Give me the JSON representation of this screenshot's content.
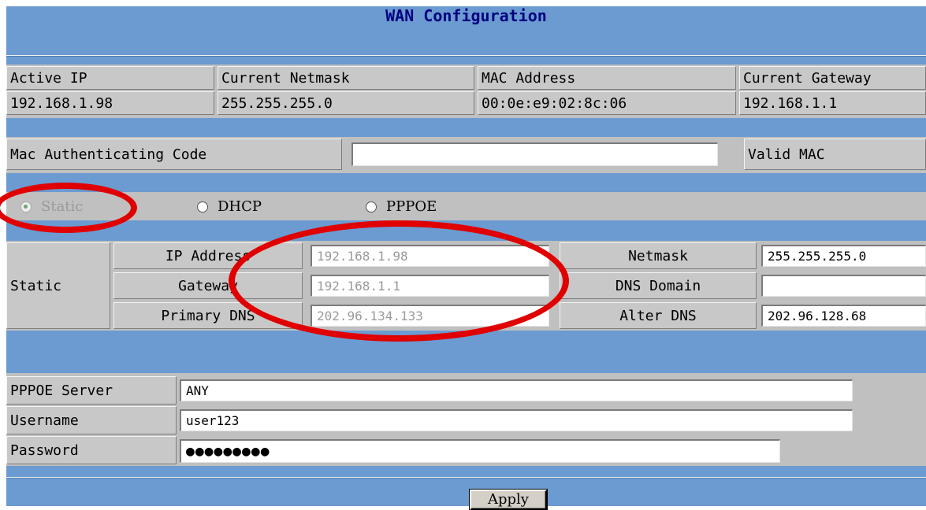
{
  "page_title": "WAN Configuration",
  "status": {
    "headers": [
      "Active IP",
      "Current Netmask",
      "MAC Address",
      "Current Gateway"
    ],
    "values": [
      "192.168.1.98",
      "255.255.255.0",
      "00:0e:e9:02:8c:06",
      "192.168.1.1"
    ]
  },
  "mac_auth": {
    "label": "Mac Authenticating Code",
    "value": "",
    "valid_label": "Valid MAC"
  },
  "mode": {
    "options": [
      "Static",
      "DHCP",
      "PPPOE"
    ],
    "selected": "Static"
  },
  "static": {
    "section_label": "Static",
    "ip_address_label": "IP Address",
    "ip_address": "192.168.1.98",
    "gateway_label": "Gateway",
    "gateway": "192.168.1.1",
    "primary_dns_label": "Primary DNS",
    "primary_dns": "202.96.134.133",
    "netmask_label": "Netmask",
    "netmask": "255.255.255.0",
    "dns_domain_label": "DNS Domain",
    "dns_domain": "",
    "alter_dns_label": "Alter DNS",
    "alter_dns": "202.96.128.68"
  },
  "pppoe": {
    "server_label": "PPPOE Server",
    "server": "ANY",
    "username_label": "Username",
    "username": "user123",
    "password_label": "Password",
    "password": "●●●●●●●●●"
  },
  "apply_label": "Apply",
  "colors": {
    "band": "#6b9bd0",
    "title": "#000080",
    "annotation": "#e00000"
  }
}
